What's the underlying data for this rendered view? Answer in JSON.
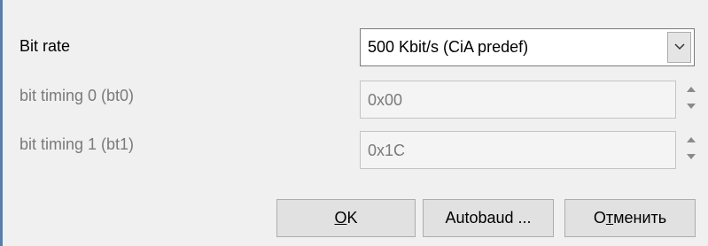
{
  "fields": {
    "bit_rate": {
      "label": "Bit rate",
      "value": "500  Kbit/s  (CiA predef)"
    },
    "bt0": {
      "label": "bit timing 0 (bt0)",
      "value": "0x00"
    },
    "bt1": {
      "label": "bit timing 1 (bt1)",
      "value": "0x1C"
    }
  },
  "buttons": {
    "ok": {
      "mnemonic": "O",
      "rest": "K"
    },
    "autobaud": {
      "label": "Autobaud ..."
    },
    "cancel": {
      "pre": "О",
      "mnemonic": "т",
      "rest": "менить"
    }
  },
  "colors": {
    "window_bg": "#f0f0f0",
    "disabled_text": "#7a7a7a",
    "accent_border": "#5b7ea7"
  },
  "icons": [
    "chevron-down-icon",
    "spin-up-icon",
    "spin-down-icon"
  ]
}
